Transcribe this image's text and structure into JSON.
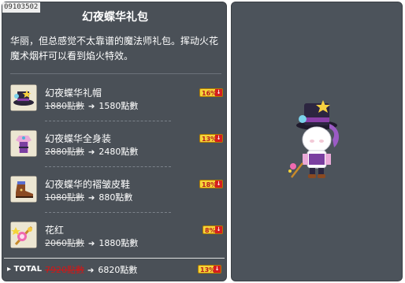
{
  "item_id": "09103502",
  "title": "幻夜蝶华礼包",
  "description": "华丽，但总感觉不太靠谱的魔法师礼包。挥动火花魔术烟杆可以看到焰火特效。",
  "items": [
    {
      "name": "幻夜蝶华礼帽",
      "old_price": "1880點數",
      "new_price": "1580點數",
      "discount": "16%",
      "icon": "top-hat-icon"
    },
    {
      "name": "幻夜蝶华全身装",
      "old_price": "2880點數",
      "new_price": "2480點數",
      "discount": "13%",
      "icon": "overall-outfit-icon"
    },
    {
      "name": "幻夜蝶华的褶皱皮鞋",
      "old_price": "1080點數",
      "new_price": "880點數",
      "discount": "18%",
      "icon": "leather-shoe-icon"
    },
    {
      "name": "花红",
      "old_price": "2060點數",
      "new_price": "1880點數",
      "discount": "8%",
      "icon": "flower-pipe-icon"
    }
  ],
  "total": {
    "label": "TOTAL",
    "old_price": "7920點數",
    "new_price": "6820點數",
    "discount": "13%"
  },
  "colors": {
    "panel": "#4a5057",
    "badge": "#f5d43a",
    "badge_text": "#b81c1c",
    "total_old": "#d01818"
  }
}
